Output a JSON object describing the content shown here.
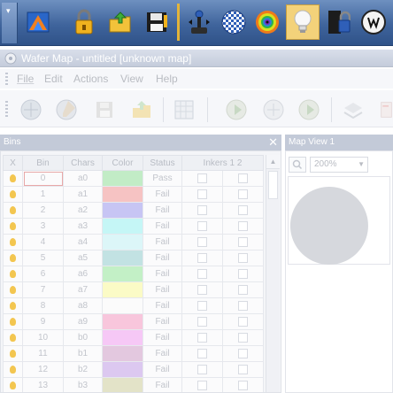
{
  "window": {
    "title": "Wafer Map - untitled [unknown map]"
  },
  "menu": [
    "File",
    "Edit",
    "Actions",
    "View",
    "Help"
  ],
  "top_toolbar": {
    "icons": [
      "app-logo-icon",
      "lock-icon",
      "open-folder-icon",
      "save-disk-icon",
      "joystick-icon",
      "wafer-grid-icon",
      "eye-icon",
      "light-bulb-icon",
      "lock-file-icon",
      "pen-circle-icon"
    ]
  },
  "bins_panel": {
    "title": "Bins",
    "close_glyph": "✕",
    "columns": [
      "X",
      "Bin",
      "Chars",
      "Color",
      "Status",
      "Inkers 1 2"
    ],
    "rows": [
      {
        "bin": "0",
        "chars": "a0",
        "color": "#c2ecc6",
        "status": "Pass"
      },
      {
        "bin": "1",
        "chars": "a1",
        "color": "#f6c3c3",
        "status": "Fail"
      },
      {
        "bin": "2",
        "chars": "a2",
        "color": "#c7c5f4",
        "status": "Fail"
      },
      {
        "bin": "3",
        "chars": "a3",
        "color": "#c5f6f6",
        "status": "Fail"
      },
      {
        "bin": "4",
        "chars": "a4",
        "color": "#dcf6f8",
        "status": "Fail"
      },
      {
        "bin": "5",
        "chars": "a5",
        "color": "#c2e2e3",
        "status": "Fail"
      },
      {
        "bin": "6",
        "chars": "a6",
        "color": "#c3f0c6",
        "status": "Fail"
      },
      {
        "bin": "7",
        "chars": "a7",
        "color": "#fbfbc6",
        "status": "Fail"
      },
      {
        "bin": "8",
        "chars": "a8",
        "color": "#fbfbfb",
        "status": "Fail"
      },
      {
        "bin": "9",
        "chars": "a9",
        "color": "#f8c6dc",
        "status": "Fail"
      },
      {
        "bin": "10",
        "chars": "b0",
        "color": "#f6c8f6",
        "status": "Fail"
      },
      {
        "bin": "11",
        "chars": "b1",
        "color": "#e3c8df",
        "status": "Fail"
      },
      {
        "bin": "12",
        "chars": "b2",
        "color": "#dcc8f0",
        "status": "Fail"
      },
      {
        "bin": "13",
        "chars": "b3",
        "color": "#e3e3c8",
        "status": "Fail"
      }
    ]
  },
  "map_panel": {
    "title": "Map View 1",
    "zoom": "200%",
    "wafer_color": "#d6d8dd"
  }
}
